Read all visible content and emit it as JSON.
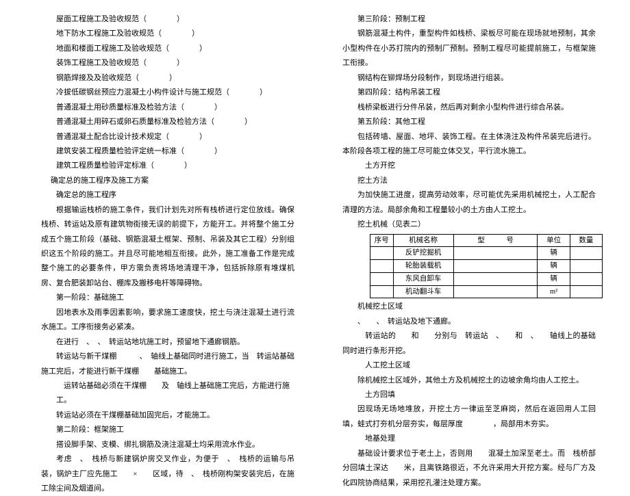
{
  "left": {
    "l1": "屋面工程施工及验收规范（　　　　）",
    "l2": "地下防水工程施工及验收规范（　　　　）",
    "l3": "地面和楼面工程施工及验收规范（　　　　）",
    "l4": "装饰工程施工及验收规范（　　　　）",
    "l5": "钢筋焊接及及验收规范（　　　　）",
    "l6": "冷拔低碳钢丝预应力混凝土小构件设计与施工规范（　　　　）",
    "l7": "普通混凝土用砂质量标准及检验方法（　　　　）",
    "l8": "普通混凝土用碎石或卵石质量标准及检验方法（　　　　）",
    "l9": "普通混凝土配合比设计技术规定（　　　　）",
    "l10": "建筑安装工程质量检验评定统一标准（　　　　）",
    "l11": "建筑工程质量检验评定标准（　　　　）",
    "l12": "确定总的施工程序及施工方案",
    "l13": "确定总的施工程序",
    "l14": "根据输运栈桥的施工条件，我们计划先对所有栈桥进行定位放线。确保栈桥、转运站及原有建筑物街接无误的前提下，方能开工。并将整个施工分成五个施工阶段（基础、钢筋混凝土框架、预制、吊装及其它工程）分别组织这五个阶段的施工。并且尽可能地相互衔接。此外，施工准备工作是完成整个施工的必要条件，甲方需负责将场地清理干净，包括拆除原有堆煤机房、复合肥装卸站台、棚库及搬移电杆等障碍物。",
    "l15": "第一阶段：基础施工",
    "l16": "因地表水及雨季因素影响，要求施工速度快，挖土与浇注混凝土进行流水施工。工序衔接务必紧凑。",
    "l17": "在进行　、　、　转运站地坑施工时，预留地下通廊钢筋。",
    "l18": "转运站与新干煤棚　　　、　轴线上基础同时进行施工，当　转运站基础施工完后，才能进行新干煤棚　　基础施工。",
    "l19": "　运转站基础必须在干煤棚　　及　轴线上基础施工完后，方能进行施工。",
    "l20": "转运站必须在干煤棚基础加固完后，才能施工。",
    "l21": "第二阶段：框架施工",
    "l22": "搭设脚手架、支模、绑扎钢筋及浇注混凝土均采用流水作业。",
    "l23": "考虑　、　栈桥与新建锅炉房交叉作业，为便于　、　栈桥的运输与吊装，锅炉主厂应先施工　　×　　区域，待　、　栈桥刚构架安装完后，在施工除尘间及烟道间。"
  },
  "right": {
    "r1": "第三阶段：预制工程",
    "r2": "钢筋混凝土构件，重型构件如栈桥、梁板尽可能在现场就地预制，其余小型构件在小苏打院内的预制厂预制。预制工程尽可能提前施工，与框架施工衔接。",
    "r3": "钢结构在铆焊场分段制作，到现场进行组装。",
    "r4": "第四阶段：结构吊装工程",
    "r5": "栈桥梁板进行分件吊装，然后再对剩余小型构件进行综合吊装。",
    "r6": "第五阶段：其他工程",
    "r7": "包括砖墙、屋面、地坪、装饰工程。在主体浇注及构件吊装完后进行。本阶段各项工程的施工尽可能立体交叉，平行流水施工。",
    "r8": "　土方开挖",
    "r9": "挖土方法",
    "r10": "为加快施工进度，提高劳动效率，尽可能优先采用机械挖土，人工配合清理的方法。局部余角和工程量较小的土方由人工挖土。",
    "r11": "挖土机械（见表二）",
    "th1": "序号",
    "th2": "机械名称",
    "th3": "型　　　号",
    "th4": "单位",
    "th5": "数量",
    "tr1c2": "反铲挖掘机",
    "tr1c4": "辆",
    "tr2c2": "轮胎装载机",
    "tr2c4": "辆",
    "tr3c2": "东风自卸车",
    "tr3c4": "辆",
    "tr4c2": "机动翻斗车",
    "tr4c4": "m²",
    "r12": "机械挖土区域",
    "r13": "、　　、　转运站及地下通廊。",
    "r14": "　转运站的　　和　　分别与　转运站　、　　和　、　　轴线上的基础同时进行条形开挖。",
    "r15": "　人工挖土区域",
    "r16": "除机械挖土区域外，其他土方及机械挖土的边坡余角均由人工挖土。",
    "r17": "　土方回填",
    "r18": "因现场无场地堆放，开挖土方一律运至芝麻岗，然后在返回用人工回填，蛙式打夯机分层夯实，每层厚度　　　　，局部用木夯实。",
    "r19": "　地基处理",
    "r20": "基础设计要求位于老土上，否则用　　混凝土加深至老土。而　栈桥部分回填土深达　　米，且离铁路很近，不允许采用大开挖方案。经与厂方及化四院协商结果，采用挖孔灌注处理方案。"
  }
}
